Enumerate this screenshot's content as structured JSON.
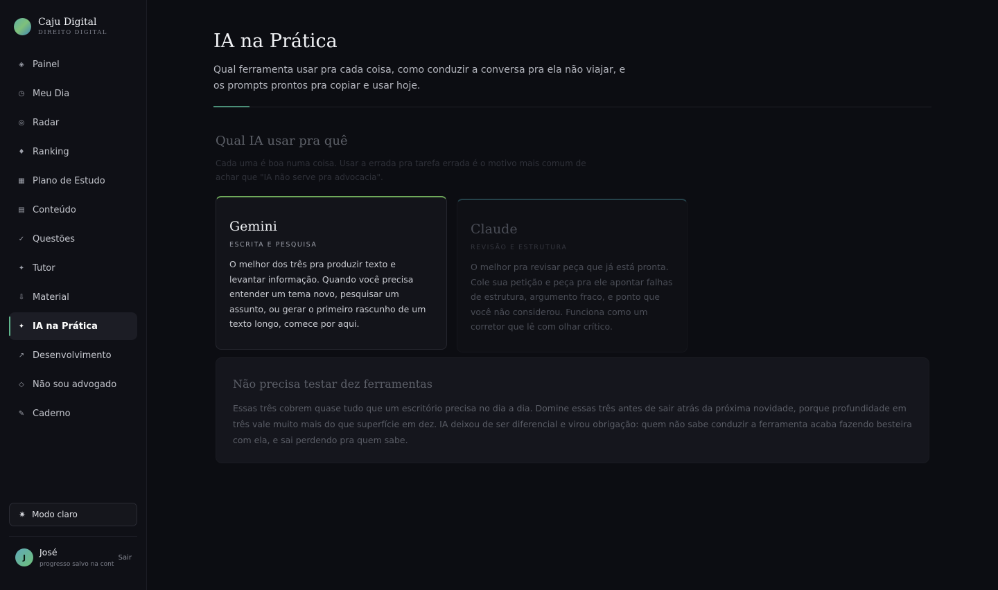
{
  "brand": {
    "name": "Caju Digital",
    "subtitle": "DIREITO DIGITAL"
  },
  "nav": [
    {
      "icon": "◈",
      "label": "Painel"
    },
    {
      "icon": "◷",
      "label": "Meu Dia"
    },
    {
      "icon": "◎",
      "label": "Radar"
    },
    {
      "icon": "♦",
      "label": "Ranking"
    },
    {
      "icon": "▦",
      "label": "Plano de Estudo"
    },
    {
      "icon": "▤",
      "label": "Conteúdo"
    },
    {
      "icon": "✓",
      "label": "Questões"
    },
    {
      "icon": "✦",
      "label": "Tutor"
    },
    {
      "icon": "⇩",
      "label": "Material"
    },
    {
      "icon": "✦",
      "label": "IA na Prática"
    },
    {
      "icon": "↗",
      "label": "Desenvolvimento"
    },
    {
      "icon": "◇",
      "label": "Não sou advogado"
    },
    {
      "icon": "✎",
      "label": "Caderno"
    }
  ],
  "active_nav": "IA na Prática",
  "mode_toggle": {
    "icon": "✷",
    "label": "Modo claro"
  },
  "user": {
    "initial": "J",
    "name": "José",
    "subtitle": "progresso salvo na cont",
    "logout": "Sair"
  },
  "page": {
    "title": "IA na Prática",
    "description": "Qual ferramenta usar pra cada coisa, como conduzir a conversa pra ela não viajar, e os prompts prontos pra copiar e usar hoje."
  },
  "section": {
    "title": "Qual IA usar pra quê",
    "description": "Cada uma é boa numa coisa. Usar a errada pra tarefa errada é o motivo mais comum de achar que \"IA não serve pra advocacia\"."
  },
  "cards": [
    {
      "title": "Gemini",
      "tag": "ESCRITA E PESQUISA",
      "body": "O melhor dos três pra produzir texto e levantar informação. Quando você precisa entender um tema novo, pesquisar um assunto, ou gerar o primeiro rascunho de um texto longo, comece por aqui.",
      "accent": "#6fa95a"
    },
    {
      "title": "Claude",
      "tag": "REVISÃO E ESTRUTURA",
      "body": "O melhor pra revisar peça que já está pronta. Cole sua petição e peça pra ele apontar falhas de estrutura, argumento fraco, e ponto que você não considerou. Funciona como um corretor que lê com olhar crítico.",
      "accent": "#25424a"
    }
  ],
  "note": {
    "title": "Não precisa testar dez ferramentas",
    "body": "Essas três cobrem quase tudo que um escritório precisa no dia a dia. Domine essas três antes de sair atrás da próxima novidade, porque profundidade em três vale muito mais do que superfície em dez. IA deixou de ser diferencial e virou obrigação: quem não sabe conduzir a ferramenta acaba fazendo besteira com ela, e sai perdendo pra quem sabe."
  }
}
